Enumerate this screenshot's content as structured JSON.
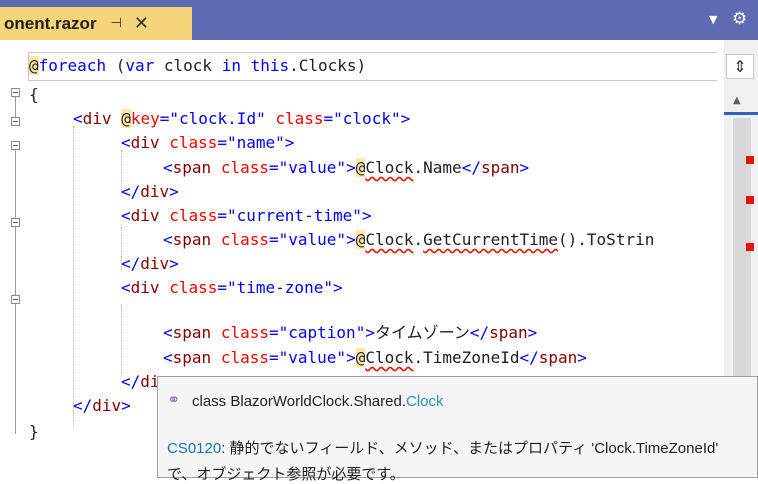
{
  "tab": {
    "title": "onent.razor",
    "pin_icon": "⊣",
    "close_icon": "✕",
    "dropdown_icon": "▼",
    "gear_icon": "⚙"
  },
  "sticky_scroll": {
    "at": "@",
    "kw_foreach": "foreach",
    "rest_a": " (",
    "kw_var": "var",
    "rest_b": " clock ",
    "kw_in": "in",
    "rest_c": " ",
    "kw_this": "this",
    "rest_d": ".Clocks)"
  },
  "code": {
    "l1": "{",
    "l2": {
      "open": "<",
      "tag": "div",
      "sp": " ",
      "at": "@",
      "attr1": "key",
      "eq1": "=",
      "val1": "\"clock.Id\"",
      "sp2": " ",
      "attr2": "class",
      "eq2": "=",
      "val2": "\"clock\"",
      "close": ">"
    },
    "l3": {
      "open": "<",
      "tag": "div",
      "sp": " ",
      "attr": "class",
      "eq": "=",
      "val": "\"name\"",
      "close": ">"
    },
    "l4": {
      "open": "<",
      "tag": "span",
      "sp": " ",
      "attr": "class",
      "eq": "=",
      "val": "\"value\"",
      "close": ">",
      "at": "@",
      "err": "Clock",
      "rest": ".Name",
      "end_open": "</",
      "end_tag": "span",
      "end_close": ">"
    },
    "l5": {
      "open": "</",
      "tag": "div",
      "close": ">"
    },
    "l6": {
      "open": "<",
      "tag": "div",
      "sp": " ",
      "attr": "class",
      "eq": "=",
      "val": "\"current-time\"",
      "close": ">"
    },
    "l7": {
      "open": "<",
      "tag": "span",
      "sp": " ",
      "attr": "class",
      "eq": "=",
      "val": "\"value\"",
      "close": ">",
      "at": "@",
      "err": "Clock",
      "rest_a": ".",
      "err2": "GetCurrentTime",
      "rest_b": "().ToStrin"
    },
    "l8": {
      "open": "</",
      "tag": "div",
      "close": ">"
    },
    "l9": {
      "open": "<",
      "tag": "div",
      "sp": " ",
      "attr": "class",
      "eq": "=",
      "val": "\"time-zone\"",
      "close": ">"
    },
    "l10": {
      "open": "<",
      "tag": "span",
      "sp": " ",
      "attr": "class",
      "eq": "=",
      "val": "\"caption\"",
      "close": ">",
      "text": "タイムゾーン",
      "end_open": "</",
      "end_tag": "span",
      "end_close": ">"
    },
    "l11": {
      "open": "<",
      "tag": "span",
      "sp": " ",
      "attr": "class",
      "eq": "=",
      "val": "\"value\"",
      "close": ">",
      "at": "@",
      "err": "Clock",
      "rest": ".TimeZoneId",
      "end_open": "</",
      "end_tag": "span",
      "end_close": ">"
    },
    "l12": {
      "open": "</",
      "tag": "di"
    },
    "l13": {
      "open": "</",
      "tag": "div",
      "close": ">"
    },
    "l14": "}"
  },
  "scrollbar": {
    "split_icon": "⇕",
    "up_icon": "▲"
  },
  "tooltip": {
    "icon": "⚭",
    "keyword": "class",
    "namespace": " BlazorWorldClock.Shared.",
    "class_name": "Clock",
    "error_code": "CS0120",
    "message": ": 静的でないフィールド、メソッド、またはプロパティ 'Clock.TimeZoneId'",
    "message_cont": "で、オブジェクト参照が必要です。"
  },
  "colors": {
    "tabbar": "#5e6bb1",
    "active_tab": "#f6d47a",
    "tag": "#800000",
    "attribute": "#ff0000",
    "value": "#0000ff",
    "error": "#e51400",
    "class_type": "#2b91af"
  }
}
